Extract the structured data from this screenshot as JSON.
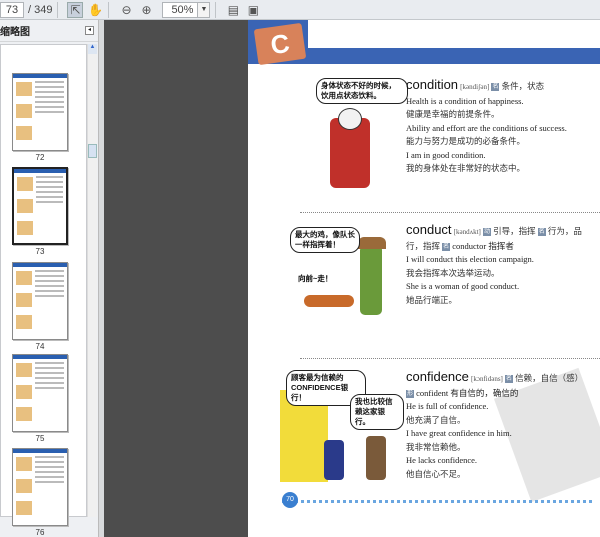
{
  "toolbar": {
    "page_current": "73",
    "page_total": "/ 349",
    "zoom": "50%",
    "icons": [
      "select-tool-icon",
      "hand-tool-icon",
      "zoom-out-icon",
      "zoom-in-icon",
      "fit-page-icon",
      "fit-width-icon"
    ]
  },
  "sidebar": {
    "title": "缩略图",
    "thumbnails": [
      {
        "label": "72"
      },
      {
        "label": "73"
      },
      {
        "label": "74"
      },
      {
        "label": "75"
      },
      {
        "label": "76"
      }
    ]
  },
  "page": {
    "letter": "C",
    "page_number": "70",
    "entries": [
      {
        "word": "condition",
        "phonetic": "[kәndiʃәn]",
        "pos": "名",
        "meaning": "条件，状态",
        "lines": [
          "Health is a condition of happiness.",
          "健康是幸福的前提条件。",
          "Ability and effort are the conditions of success.",
          "能力与努力是成功的必备条件。",
          "I am in good condition.",
          "我的身体处在非常好的状态中。"
        ],
        "bubbles": [
          "身体状态不好的时候，饮用点状态饮料。"
        ]
      },
      {
        "word": "conduct",
        "phonetic": "[kәndʌkt]",
        "pos": "动",
        "meaning": "引导，指挥",
        "pos2": "名",
        "meaning2": "行为，品行，指挥",
        "pos3": "名",
        "derived": "conductor 指挥者",
        "lines": [
          "I will conduct this election campaign.",
          "我会指挥本次选举运动。",
          "She is a woman of good conduct.",
          "她品行端正。"
        ],
        "bubbles": [
          "最大的鸡，像队长一样指挥着！",
          "向前~走！"
        ]
      },
      {
        "word": "confidence",
        "phonetic": "[kɔnfidәns]",
        "pos": "名",
        "meaning": "信赖，自信（感）",
        "pos2": "形",
        "derived": "confident 有自信的，确信的",
        "lines": [
          "He is full of confidence.",
          "他充满了自信。",
          "I have great confidence in him.",
          "我非常信赖他。",
          "He lacks confidence.",
          "他自信心不足。"
        ],
        "bubbles": [
          "顾客最为信赖的CONFIDENCE银行！",
          "我也比较信赖这家银行。"
        ]
      }
    ]
  }
}
